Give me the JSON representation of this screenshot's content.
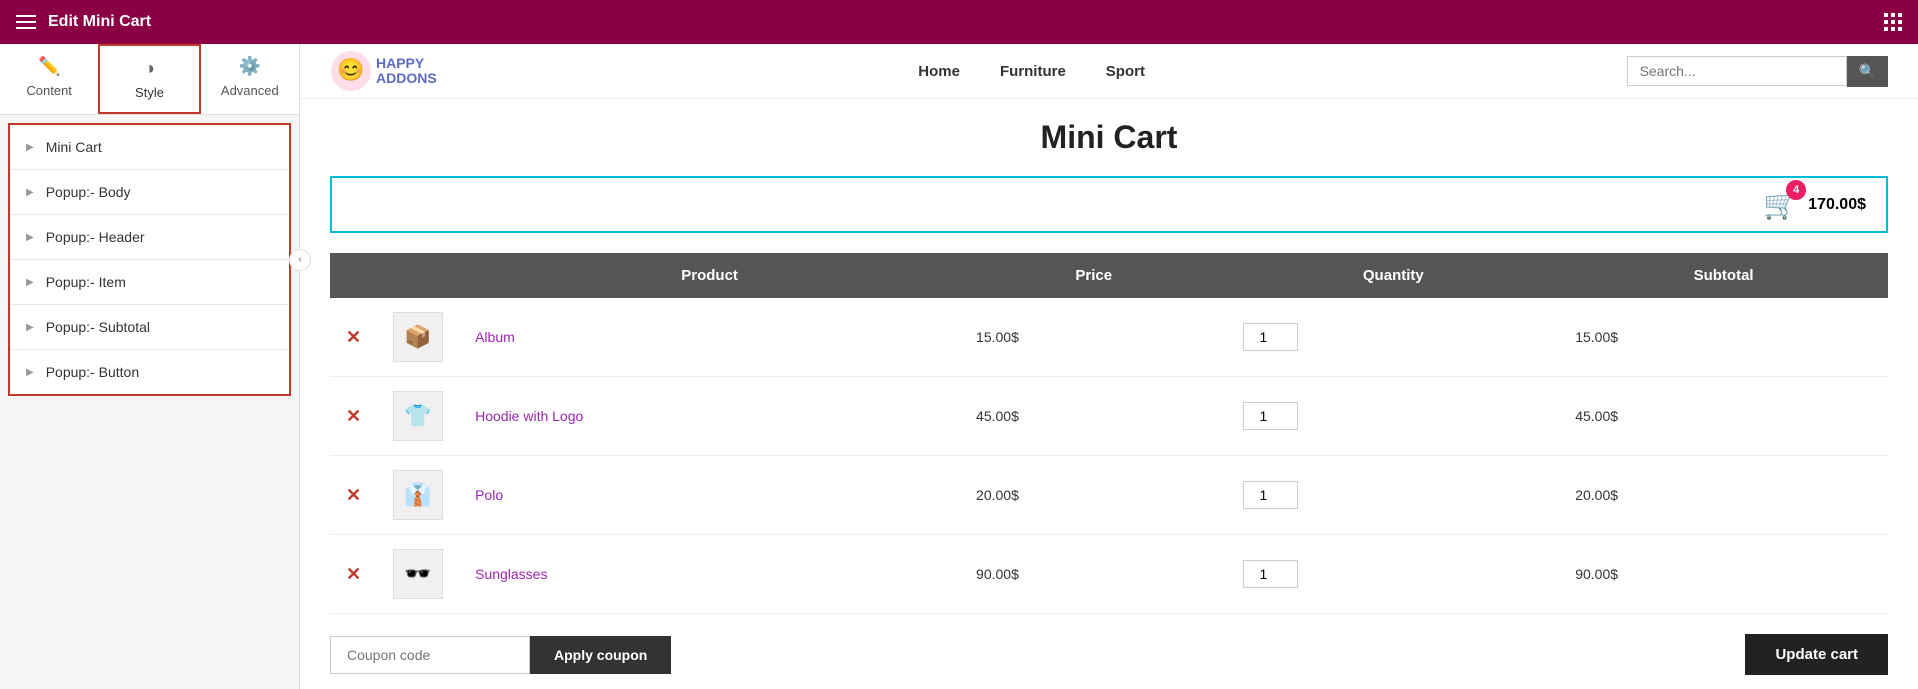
{
  "topbar": {
    "title": "Edit Mini Cart"
  },
  "tabs": [
    {
      "id": "content",
      "label": "Content",
      "icon": "✏️"
    },
    {
      "id": "style",
      "label": "Style",
      "icon": "◑",
      "active": true
    },
    {
      "id": "advanced",
      "label": "Advanced",
      "icon": "⚙️"
    }
  ],
  "sidebar": {
    "items": [
      {
        "label": "Mini Cart"
      },
      {
        "label": "Popup:- Body"
      },
      {
        "label": "Popup:- Header"
      },
      {
        "label": "Popup:- Item"
      },
      {
        "label": "Popup:- Subtotal"
      },
      {
        "label": "Popup:- Button"
      }
    ]
  },
  "nav": {
    "logo": {
      "happy": "HAPPY",
      "addons": "ADDONS"
    },
    "links": [
      "Home",
      "Furniture",
      "Sport"
    ],
    "search_placeholder": "Search..."
  },
  "page": {
    "title": "Mini Cart",
    "cart_count": "4",
    "cart_total": "170.00$"
  },
  "table": {
    "headers": [
      "",
      "",
      "Product",
      "Price",
      "Quantity",
      "Subtotal"
    ],
    "rows": [
      {
        "name": "Album",
        "price": "15.00$",
        "quantity": "1",
        "subtotal": "15.00$",
        "icon": "📦"
      },
      {
        "name": "Hoodie with Logo",
        "price": "45.00$",
        "quantity": "1",
        "subtotal": "45.00$",
        "icon": "👕"
      },
      {
        "name": "Polo",
        "price": "20.00$",
        "quantity": "1",
        "subtotal": "20.00$",
        "icon": "👔"
      },
      {
        "name": "Sunglasses",
        "price": "90.00$",
        "quantity": "1",
        "subtotal": "90.00$",
        "icon": "🕶️"
      }
    ]
  },
  "actions": {
    "coupon_placeholder": "Coupon code",
    "apply_btn": "Apply coupon",
    "update_btn": "Update cart"
  }
}
